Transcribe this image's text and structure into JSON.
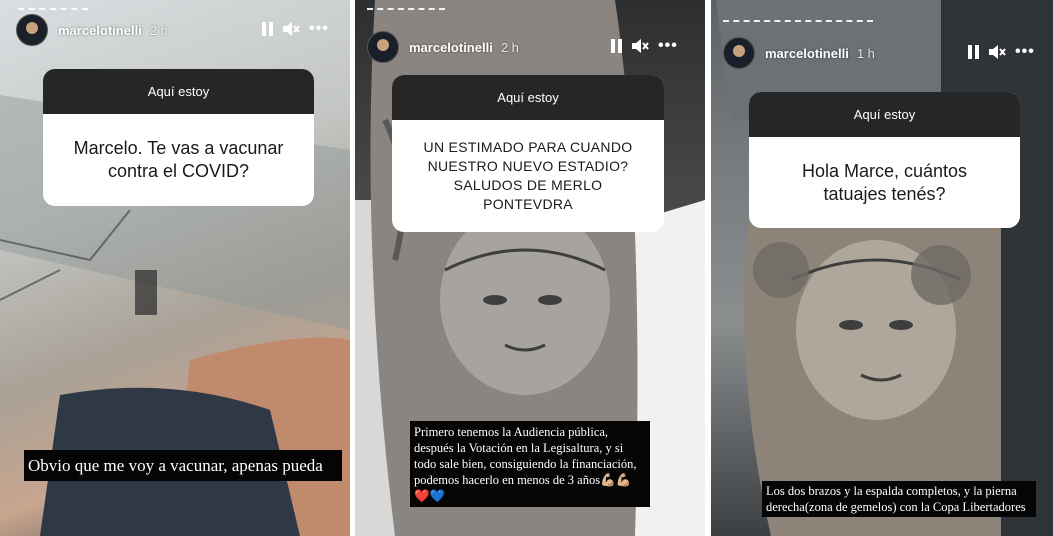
{
  "stories": [
    {
      "username": "marcelotinelli",
      "time": "2 h",
      "question_header": "Aquí estoy",
      "question": "Marcelo. Te vas a vacunar contra el COVID?",
      "answer": "Obvio que me voy a vacunar, apenas pueda"
    },
    {
      "username": "marcelotinelli",
      "time": "2 h",
      "question_header": "Aquí estoy",
      "question": "UN ESTIMADO PARA CUANDO NUESTRO NUEVO ESTADIO? SALUDOS DE MERLO PONTEVDRA",
      "answer": "Primero tenemos la Audiencia pública, después la Votación en la Legisaltura, y si todo sale bien, consiguiendo la financiación, podemos hacerlo en menos de 3 años💪🏼💪🏼❤️💙"
    },
    {
      "username": "marcelotinelli",
      "time": "1 h",
      "question_header": "Aquí estoy",
      "question": "Hola Marce, cuántos tatuajes tenés?",
      "answer": "Los dos brazos y la espalda completos, y la pierna derecha(zona de gemelos) con la Copa Libertadores"
    }
  ],
  "icons": {
    "pause": "pause-icon",
    "mute": "speaker-muted-icon",
    "more": "more-options-icon"
  }
}
